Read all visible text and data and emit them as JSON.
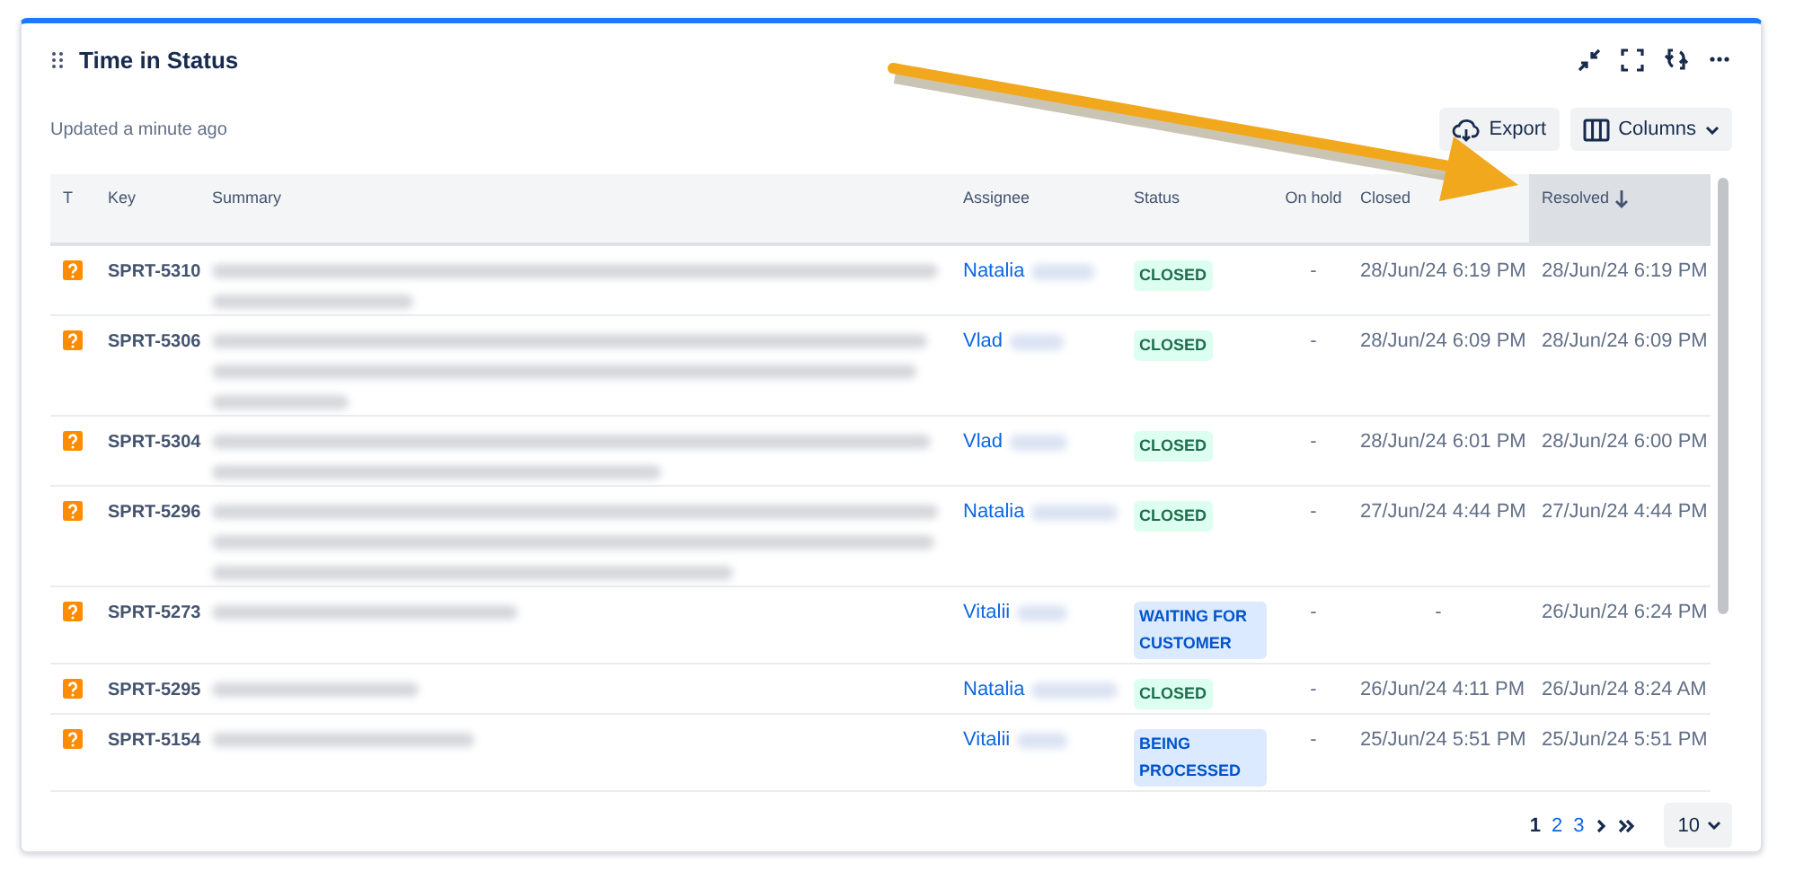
{
  "panel": {
    "title": "Time in Status",
    "updated": "Updated a minute ago",
    "actions": [
      {
        "label": "Export",
        "kind": "export"
      },
      {
        "label": "Columns",
        "kind": "columns"
      }
    ]
  },
  "table": {
    "columns": [
      {
        "label": "T",
        "sorted": false
      },
      {
        "label": "Key",
        "sorted": false
      },
      {
        "label": "Summary",
        "sorted": false
      },
      {
        "label": "Assignee",
        "sorted": false
      },
      {
        "label": "Status",
        "sorted": false
      },
      {
        "label": "On hold",
        "sorted": false
      },
      {
        "label": "Closed",
        "sorted": false
      },
      {
        "label": "Resolved",
        "sorted": true
      }
    ],
    "rows": [
      {
        "key": "SPRT-5310",
        "assignee": "Natalia",
        "status": "CLOSED",
        "kind": "done",
        "on_hold": "-",
        "closed": "28/Jun/24 6:19 PM",
        "resolved": "28/Jun/24 6:19 PM"
      },
      {
        "key": "SPRT-5306",
        "assignee": "Vlad",
        "status": "CLOSED",
        "kind": "done",
        "on_hold": "-",
        "closed": "28/Jun/24 6:09 PM",
        "resolved": "28/Jun/24 6:09 PM"
      },
      {
        "key": "SPRT-5304",
        "assignee": "Vlad",
        "status": "CLOSED",
        "kind": "done",
        "on_hold": "-",
        "closed": "28/Jun/24 6:01 PM",
        "resolved": "28/Jun/24 6:00 PM"
      },
      {
        "key": "SPRT-5296",
        "assignee": "Natalia",
        "status": "CLOSED",
        "kind": "done",
        "on_hold": "-",
        "closed": "27/Jun/24 4:44 PM",
        "resolved": "27/Jun/24 4:44 PM"
      },
      {
        "key": "SPRT-5273",
        "assignee": "Vitalii",
        "status": "WAITING FOR CUSTOMER",
        "kind": "progress",
        "on_hold": "-",
        "closed": "-",
        "resolved": "26/Jun/24 6:24 PM"
      },
      {
        "key": "SPRT-5295",
        "assignee": "Natalia",
        "status": "CLOSED",
        "kind": "done",
        "on_hold": "-",
        "closed": "26/Jun/24 4:11 PM",
        "resolved": "26/Jun/24 8:24 AM"
      },
      {
        "key": "SPRT-5154",
        "assignee": "Vitalii",
        "status": "BEING PROCESSED",
        "kind": "progress",
        "on_hold": "-",
        "closed": "25/Jun/24 5:51 PM",
        "resolved": "25/Jun/24 5:51 PM"
      }
    ]
  },
  "pagination": {
    "pages": [
      {
        "label": "1",
        "selected": true
      },
      {
        "label": "2",
        "selected": false
      },
      {
        "label": "3",
        "selected": false
      }
    ],
    "page_size": "10"
  }
}
